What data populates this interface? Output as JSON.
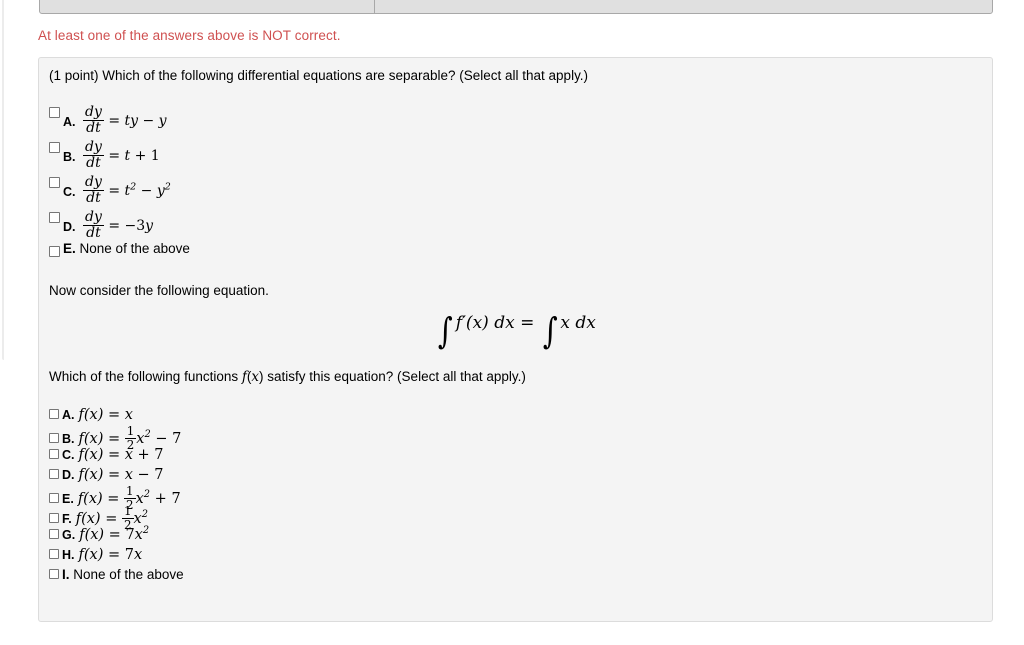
{
  "top_bar": {
    "visible": true,
    "cells": [
      "",
      ""
    ]
  },
  "warning": {
    "text": "At least one of the answers above is NOT correct.",
    "color": "#cf5050"
  },
  "problem": {
    "prompt": "(1 point) Which of the following differential equations are separable? (Select all that apply.)",
    "separable_options": [
      {
        "letter": "A.",
        "lhs_num": "dy",
        "lhs_den": "dt",
        "rel": "=",
        "rhs": "ty − y",
        "checked": false
      },
      {
        "letter": "B.",
        "lhs_num": "dy",
        "lhs_den": "dt",
        "rel": "=",
        "rhs": "t + 1",
        "checked": false
      },
      {
        "letter": "C.",
        "lhs_num": "dy",
        "lhs_den": "dt",
        "rel": "=",
        "rhs": "t² − y²",
        "checked": false
      },
      {
        "letter": "D.",
        "lhs_num": "dy",
        "lhs_den": "dt",
        "rel": "=",
        "rhs": "−3y",
        "checked": false
      }
    ],
    "separable_none": {
      "letter": "E.",
      "label": "None of the above",
      "checked": false
    },
    "consider_text": "Now consider the following equation.",
    "display_equation": {
      "left_integral": "∫",
      "left_body": "f′(x) dx",
      "relation": "=",
      "right_integral": "∫",
      "right_body": "x dx"
    },
    "which_text": "Which of the following functions f(x) satisfy this equation? (Select all that apply.)",
    "fx_options": [
      {
        "letter": "A.",
        "expr": "f(x) = x",
        "checked": false
      },
      {
        "letter": "B.",
        "expr": "f(x) = ½x² − 7",
        "checked": false
      },
      {
        "letter": "C.",
        "expr": "f(x) = x + 7",
        "checked": false
      },
      {
        "letter": "D.",
        "expr": "f(x) = x − 7",
        "checked": false
      },
      {
        "letter": "E.",
        "expr": "f(x) = ½x² + 7",
        "checked": false
      },
      {
        "letter": "F.",
        "expr": "f(x) = ½x²",
        "checked": false
      },
      {
        "letter": "G.",
        "expr": "f(x) = 7x²",
        "checked": false
      },
      {
        "letter": "H.",
        "expr": "f(x) = 7x",
        "checked": false
      }
    ],
    "fx_none": {
      "letter": "I.",
      "label": "None of the above",
      "checked": false
    }
  }
}
